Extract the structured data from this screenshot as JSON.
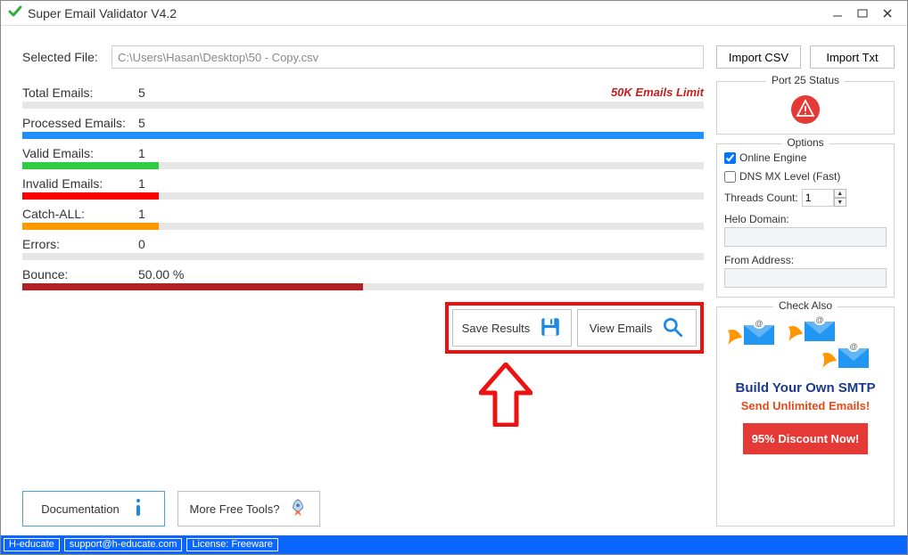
{
  "window": {
    "title": "Super Email Validator V4.2"
  },
  "main": {
    "selected_file_label": "Selected File:",
    "selected_file_value": "C:\\Users\\Hasan\\Desktop\\50 - Copy.csv",
    "limit_text": "50K Emails Limit",
    "stats": {
      "total": {
        "label": "Total Emails:",
        "value": "5",
        "fill_pct": 0,
        "color": "#e6e6e6"
      },
      "processed": {
        "label": "Processed Emails:",
        "value": "5",
        "fill_pct": 100,
        "color": "#1e90ff"
      },
      "valid": {
        "label": "Valid Emails:",
        "value": "1",
        "fill_pct": 20,
        "color": "#2ecc40"
      },
      "invalid": {
        "label": "Invalid Emails:",
        "value": "1",
        "fill_pct": 20,
        "color": "#ff0000"
      },
      "catchall": {
        "label": "Catch-ALL:",
        "value": "1",
        "fill_pct": 20,
        "color": "#ff9900"
      },
      "errors": {
        "label": "Errors:",
        "value": "0",
        "fill_pct": 0,
        "color": "#e6e6e6"
      },
      "bounce": {
        "label": "Bounce:",
        "value": "50.00 %",
        "fill_pct": 50,
        "color": "#b22222"
      }
    },
    "save_results_label": "Save Results",
    "view_emails_label": "View Emails",
    "documentation_label": "Documentation",
    "more_tools_label": "More Free Tools?"
  },
  "side": {
    "import_csv_label": "Import CSV",
    "import_txt_label": "Import Txt",
    "port_status_legend": "Port  25 Status",
    "options_legend": "Options",
    "online_engine_label": "Online Engine",
    "online_engine_checked": true,
    "dns_mx_label": "DNS MX Level (Fast)",
    "dns_mx_checked": false,
    "threads_label": "Threads Count:",
    "threads_value": "1",
    "helo_label": "Helo Domain:",
    "helo_value": "",
    "from_label": "From Address:",
    "from_value": "",
    "check_also_legend": "Check Also",
    "promo_title": "Build Your Own SMTP",
    "promo_subtitle": "Send Unlimited Emails!",
    "promo_button": "95% Discount Now!"
  },
  "statusbar": {
    "left": "H-educate",
    "email": "support@h-educate.com",
    "license": "License: Freeware"
  }
}
